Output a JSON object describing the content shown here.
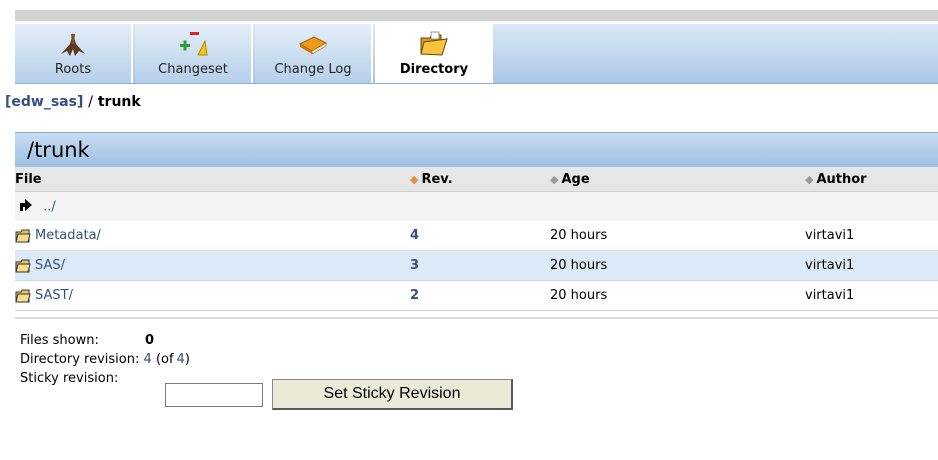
{
  "tabs": [
    {
      "label": "Roots",
      "icon": "tree-roots-icon",
      "active": false
    },
    {
      "label": "Changeset",
      "icon": "changeset-icon",
      "active": false
    },
    {
      "label": "Change Log",
      "icon": "changelog-book-icon",
      "active": false
    },
    {
      "label": "Directory",
      "icon": "folder-open-icon",
      "active": true
    }
  ],
  "breadcrumb": {
    "repo": "[edw_sas]",
    "separator": "/",
    "current": "trunk"
  },
  "panel": {
    "title": "/trunk",
    "columns": {
      "file": "File",
      "rev": "Rev.",
      "age": "Age",
      "author": "Author"
    },
    "parent_link": "../",
    "rows": [
      {
        "name": "Metadata/",
        "rev": "4",
        "age": "20 hours",
        "author": "virtavi1"
      },
      {
        "name": "SAS/",
        "rev": "3",
        "age": "20 hours",
        "author": "virtavi1"
      },
      {
        "name": "SAST/",
        "rev": "2",
        "age": "20 hours",
        "author": "virtavi1"
      }
    ]
  },
  "info": {
    "files_shown_label": "Files shown:",
    "files_shown_value": "0",
    "dir_rev_label": "Directory revision:",
    "dir_rev_value": "4",
    "dir_rev_of": "(of",
    "dir_rev_total": "4",
    "dir_rev_close": ")",
    "sticky_label": "Sticky revision:",
    "sticky_value": "",
    "sticky_button": "Set Sticky Revision"
  },
  "colors": {
    "link": "#37507c",
    "header_blue": "#9dbfe3",
    "selected_row": "#dceaf7",
    "active_sort": "#e3913a"
  }
}
